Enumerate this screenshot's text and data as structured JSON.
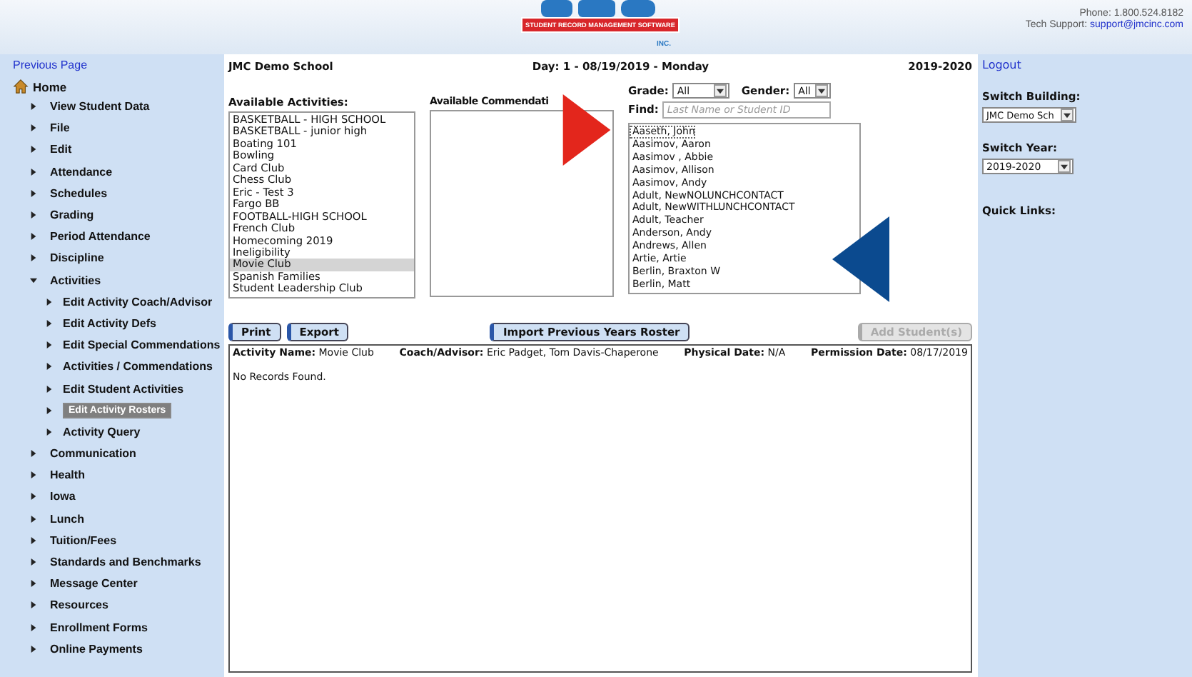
{
  "header": {
    "logo": {
      "banner": "STUDENT RECORD MANAGEMENT SOFTWARE",
      "suffix": "INC."
    },
    "phone": "Phone: 1.800.524.8182",
    "support_label": "Tech Support:",
    "support_link": "support@jmcinc.com"
  },
  "sidebar": {
    "back_link": "Previous Page",
    "home": "Home",
    "items": [
      {
        "label": "View Student Data",
        "expanded": false
      },
      {
        "label": "File",
        "expanded": false
      },
      {
        "label": "Edit",
        "expanded": false
      },
      {
        "label": "Attendance",
        "expanded": false
      },
      {
        "label": "Schedules",
        "expanded": false
      },
      {
        "label": "Grading",
        "expanded": false
      },
      {
        "label": "Period Attendance",
        "expanded": false
      },
      {
        "label": "Discipline",
        "expanded": false
      },
      {
        "label": "Activities",
        "expanded": true,
        "children": [
          {
            "label": "Edit Activity Coach/Advisor",
            "selected": false
          },
          {
            "label": "Edit Activity Defs",
            "selected": false
          },
          {
            "label": "Edit Special Commendations",
            "selected": false
          },
          {
            "label": "Activities / Commendations",
            "selected": false
          },
          {
            "label": "Edit Student Activities",
            "selected": false
          },
          {
            "label": "Edit Activity Rosters",
            "selected": true
          },
          {
            "label": "Activity Query",
            "selected": false
          }
        ]
      },
      {
        "label": "Communication",
        "expanded": false
      },
      {
        "label": "Health",
        "expanded": false
      },
      {
        "label": "Iowa",
        "expanded": false
      },
      {
        "label": "Lunch",
        "expanded": false
      },
      {
        "label": "Tuition/Fees",
        "expanded": false
      },
      {
        "label": "Standards and Benchmarks",
        "expanded": false
      },
      {
        "label": "Message Center",
        "expanded": false
      },
      {
        "label": "Resources",
        "expanded": false
      },
      {
        "label": "Enrollment Forms",
        "expanded": false
      },
      {
        "label": "Online Payments",
        "expanded": false
      }
    ]
  },
  "topline": {
    "school": "JMC Demo School",
    "day": "Day: 1 - 08/19/2019 - Monday",
    "year": "2019-2020"
  },
  "activities": {
    "label": "Available Activities:",
    "items": [
      {
        "label": "BASKETBALL - HIGH SCHOOL",
        "selected": false
      },
      {
        "label": "BASKETBALL - junior high",
        "selected": false
      },
      {
        "label": "Boating 101",
        "selected": false
      },
      {
        "label": "Bowling",
        "selected": false
      },
      {
        "label": "Card Club",
        "selected": false
      },
      {
        "label": "Chess Club",
        "selected": false
      },
      {
        "label": "Eric - Test 3",
        "selected": false
      },
      {
        "label": "Fargo BB",
        "selected": false
      },
      {
        "label": "FOOTBALL-HIGH SCHOOL",
        "selected": false
      },
      {
        "label": "French Club",
        "selected": false
      },
      {
        "label": "Homecoming 2019",
        "selected": false
      },
      {
        "label": "Ineligibility",
        "selected": false
      },
      {
        "label": "Movie Club",
        "selected": true
      },
      {
        "label": "Spanish Families",
        "selected": false
      },
      {
        "label": "Student Leadership Club",
        "selected": false
      }
    ]
  },
  "commendations": {
    "label": "Available Commendati"
  },
  "filters": {
    "grade_label": "Grade:",
    "grade": "All",
    "gender_label": "Gender:",
    "gender": "All",
    "find_label": "Find:",
    "find_placeholder": "Last Name or Student ID"
  },
  "students": [
    {
      "name": "Aaseth, John",
      "selected": true
    },
    {
      "name": "Aasimov, Aaron",
      "selected": false
    },
    {
      "name": "Aasimov , Abbie",
      "selected": false
    },
    {
      "name": "Aasimov, Allison",
      "selected": false
    },
    {
      "name": "Aasimov, Andy",
      "selected": false
    },
    {
      "name": "Adult, NewNOLUNCHCONTACT",
      "selected": false
    },
    {
      "name": "Adult, NewWITHLUNCHCONTACT",
      "selected": false
    },
    {
      "name": "Adult, Teacher",
      "selected": false
    },
    {
      "name": "Anderson, Andy",
      "selected": false
    },
    {
      "name": "Andrews, Allen",
      "selected": false
    },
    {
      "name": "Artie, Artie",
      "selected": false
    },
    {
      "name": "Berlin, Braxton W",
      "selected": false
    },
    {
      "name": "Berlin, Matt",
      "selected": false
    }
  ],
  "buttons": [
    {
      "label": "Print",
      "disabled": false
    },
    {
      "label": "Export",
      "disabled": false
    },
    {
      "label": "Import Previous Years Roster",
      "disabled": false
    },
    {
      "label": "Add Student(s)",
      "disabled": true
    }
  ],
  "roster": {
    "fields": [
      {
        "label": "Activity Name:",
        "value": "Movie Club"
      },
      {
        "label": "Coach/Advisor:",
        "value": "Eric Padget, Tom Davis-Chaperone"
      },
      {
        "label": "Physical Date:",
        "value": "N/A"
      },
      {
        "label": "Permission Date:",
        "value": "08/17/2019"
      }
    ],
    "message": "No Records Found."
  },
  "right": {
    "logout": "Logout",
    "building_label": "Switch Building:",
    "building": "JMC Demo Sch",
    "year_label": "Switch Year:",
    "year": "2019-2020",
    "quick_links": "Quick Links:"
  },
  "annotations": [
    {
      "kind": "arrow-right",
      "color": "#e3261c"
    },
    {
      "kind": "arrow-left",
      "color": "#0b4a8f"
    }
  ]
}
